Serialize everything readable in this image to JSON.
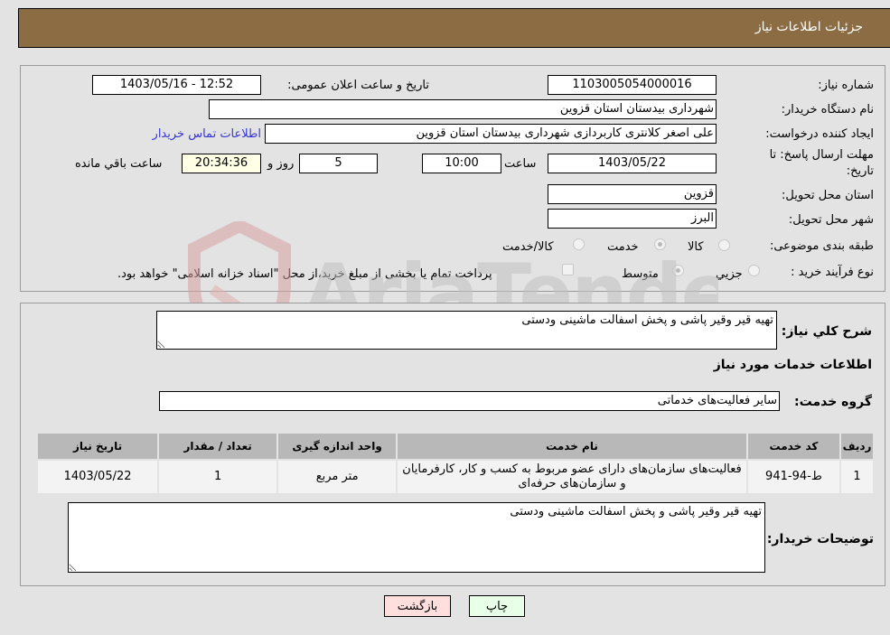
{
  "header": {
    "title": "جزئیات اطلاعات نیاز"
  },
  "details": {
    "need_number_label": "شماره نیاز:",
    "need_number": "1103005054000016",
    "announce_label": "تاریخ و ساعت اعلان عمومی:",
    "announce_value": "1403/05/16 - 12:52",
    "buyer_org_label": "نام دستگاه خریدار:",
    "buyer_org": "شهرداری بیدستان استان قزوین",
    "creator_label": "ایجاد کننده درخواست:",
    "creator": "علی اصغر کلانتری کاربردازی شهرداری بیدستان استان قزوین",
    "contact_link": "اطلاعات تماس خریدار",
    "deadline_label_line1": "مهلت ارسال پاسخ: تا",
    "deadline_label_line2": "تاریخ:",
    "deadline_date": "1403/05/22",
    "time_label": "ساعت",
    "deadline_time": "10:00",
    "days_value": "5",
    "days_label": "روز و",
    "remaining_time": "20:34:36",
    "remaining_label": "ساعت باقي مانده",
    "province_label": "استان محل تحویل:",
    "province": "قزوین",
    "city_label": "شهر محل تحویل:",
    "city": "البرز",
    "category_label": "طبقه بندی موضوعی:",
    "category_options": [
      {
        "label": "کالا",
        "checked": false
      },
      {
        "label": "خدمت",
        "checked": true
      },
      {
        "label": "کالا/خدمت",
        "checked": false
      }
    ],
    "process_label": "نوع فرآیند خرید :",
    "process_options": [
      {
        "label": "جزيي",
        "checked": false
      },
      {
        "label": "متوسط",
        "checked": true
      }
    ],
    "treasury_checkbox_checked": false,
    "treasury_text": "پرداخت تمام یا بخشی از مبلغ خرید،از محل \"اسناد خزانه اسلامی\" خواهد بود."
  },
  "summary": {
    "description_label": "شرح کلي نیاز:",
    "description": "تهیه قیر وقیر پاشی و پخش اسفالت ماشینی ودستی",
    "services_heading": "اطلاعات خدمات مورد نیاز",
    "service_group_label": "گروه خدمت:",
    "service_group": "سایر فعالیت‌های خدماتی"
  },
  "table": {
    "headers": [
      "ردیف",
      "کد خدمت",
      "نام خدمت",
      "واحد اندازه گیری",
      "تعداد / مقدار",
      "تاریخ نیاز"
    ],
    "rows": [
      {
        "row": "1",
        "code": "ط-94-941",
        "name": "فعالیت‌های سازمان‌های دارای عضو مربوط به کسب و کار، کارفرمایان و سازمان‌های حرفه‌ای",
        "unit": "متر مربع",
        "quantity": "1",
        "date": "1403/05/22"
      }
    ]
  },
  "buyer_notes": {
    "label": "توضیحات خریدار:",
    "text": "تهیه قیر وقیر پاشی و پخش اسفالت ماشینی ودستی"
  },
  "buttons": {
    "print": "چاپ",
    "back": "بازگشت"
  },
  "watermark": {
    "text": "AriaTender.neT"
  }
}
